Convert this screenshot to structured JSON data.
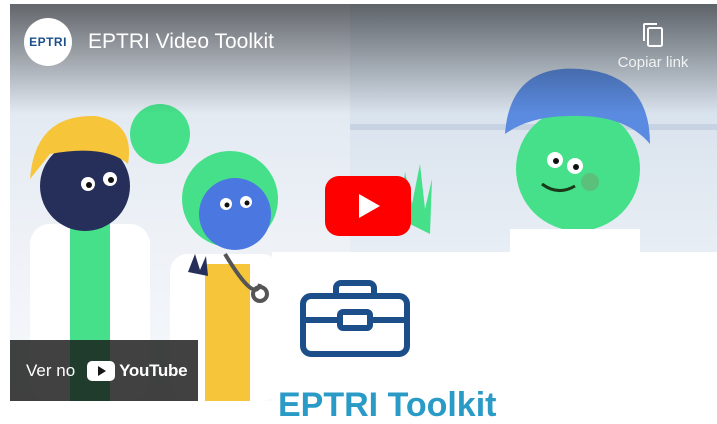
{
  "video": {
    "channel_logo_text": "EPTRI",
    "title": "EPTRI Video Toolkit",
    "copy_link_label": "Copiar link",
    "watch_on_label": "Ver no",
    "youtube_label": "YouTube",
    "panel_heading": "EPTRI Toolkit"
  },
  "colors": {
    "play_button": "#ff0000",
    "toolkit_icon": "#1c4f8a",
    "panel_heading": "#2a9bc6"
  },
  "icons": [
    "copy-icon",
    "play-icon",
    "youtube-icon",
    "toolbox-icon"
  ]
}
